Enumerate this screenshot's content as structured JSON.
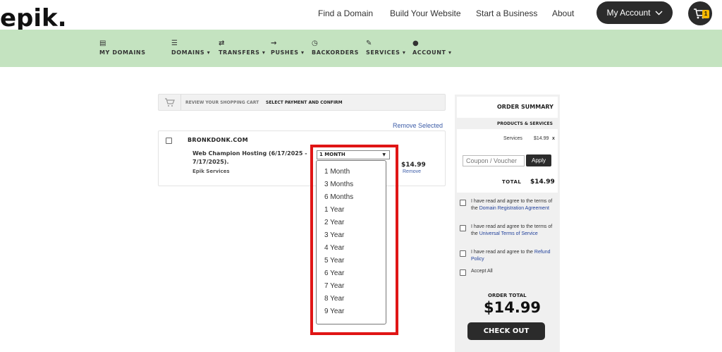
{
  "brand": {
    "logo": "epik."
  },
  "topnav": {
    "find_domain": "Find a Domain",
    "build_website": "Build Your Website",
    "start_business": "Start a Business",
    "about": "About",
    "my_account": "My Account",
    "cart_count": "1"
  },
  "mainnav": {
    "my_domains": "MY DOMAINS",
    "domains": "DOMAINS ▾",
    "transfers": "TRANSFERS ▾",
    "pushes": "PUSHES ▾",
    "backorders": "BACKORDERS",
    "services": "SERVICES ▾",
    "account": "ACCOUNT ▾"
  },
  "breadcrumb": {
    "step1": "REVIEW YOUR SHOPPING CART",
    "step2": "SELECT PAYMENT AND CONFIRM"
  },
  "cart": {
    "remove_selected": "Remove Selected",
    "domain": "BRONKDONK.COM",
    "product": "Web Champion Hosting (6/17/2025 - 7/17/2025).",
    "product_sub": "Epik Services",
    "price": "$14.99",
    "remove": "Remove",
    "selected_period": "1 MONTH",
    "period_options": [
      "1 Month",
      "3 Months",
      "6 Months",
      "1 Year",
      "2 Year",
      "3 Year",
      "4 Year",
      "5 Year",
      "6 Year",
      "7 Year",
      "8 Year",
      "9 Year"
    ]
  },
  "summary": {
    "title": "ORDER SUMMARY",
    "section": "PRODUCTS & SERVICES",
    "line_label": "Services",
    "line_price": "$14.99",
    "line_remove": "x",
    "coupon_placeholder": "Coupon / Voucher",
    "apply": "Apply",
    "total_label": "TOTAL",
    "total": "$14.99",
    "agree1_text": "I have read and agree to the terms of the ",
    "agree1_link": "Domain Registration Agreement",
    "agree2_text": "I have read and agree to the terms of the ",
    "agree2_link": "Universal Terms of Service",
    "agree3_text": "I have read and agree to the ",
    "agree3_link": "Refund Policy",
    "accept_all": "Accept All",
    "order_total_label": "ORDER TOTAL",
    "order_total": "$14.99",
    "checkout": "CHECK OUT"
  },
  "colors": {
    "nav_band": "#c4e3c0",
    "dark": "#2b2b2b",
    "highlight": "#e01515",
    "link": "#3d5da8",
    "badge": "#f5b800"
  }
}
